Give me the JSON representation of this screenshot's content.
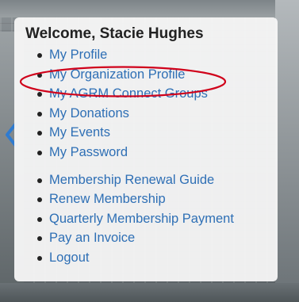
{
  "panel": {
    "welcome": "Welcome, Stacie Hughes",
    "menu_group_1": [
      "My Profile",
      "My Organization Profile",
      "My AGRM Connect Groups",
      "My Donations",
      "My Events",
      "My Password"
    ],
    "menu_group_2": [
      "Membership Renewal Guide",
      "Renew Membership",
      "Quarterly Membership Payment",
      "Pay an Invoice",
      "Logout"
    ]
  },
  "annotation": {
    "highlighted_item": "My Organization Profile",
    "color": "#d0021b"
  },
  "colors": {
    "link": "#2e6fb5",
    "arrow": "#2f7bd0",
    "panel_bg": "#f7f7f7"
  },
  "icons": {
    "left_arrow": "chevron-left-icon"
  }
}
